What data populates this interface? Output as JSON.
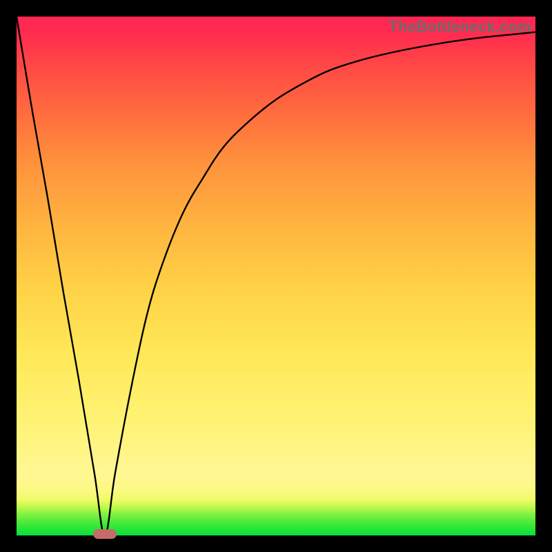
{
  "watermark": "TheBottleneck.com",
  "colors": {
    "curve": "#000000",
    "marker": "#c66a6a",
    "frame": "#000000"
  },
  "chart_data": {
    "type": "line",
    "title": "",
    "xlabel": "",
    "ylabel": "",
    "xlim": [
      0,
      100
    ],
    "ylim": [
      0,
      100
    ],
    "grid": false,
    "legend": false,
    "dip_x": 17,
    "marker": {
      "x": 17,
      "width_pct": 4.5
    },
    "series": [
      {
        "name": "bottleneck-curve",
        "x": [
          0,
          3,
          6,
          9,
          12,
          15,
          17,
          19,
          22,
          25,
          28,
          32,
          36,
          40,
          45,
          50,
          55,
          60,
          66,
          72,
          78,
          84,
          90,
          95,
          100
        ],
        "values": [
          100,
          82,
          65,
          47,
          30,
          12,
          0,
          12,
          28,
          42,
          52,
          62,
          69,
          75,
          80,
          84,
          87,
          89.5,
          91.5,
          93,
          94.2,
          95.2,
          96,
          96.5,
          97
        ]
      }
    ]
  }
}
